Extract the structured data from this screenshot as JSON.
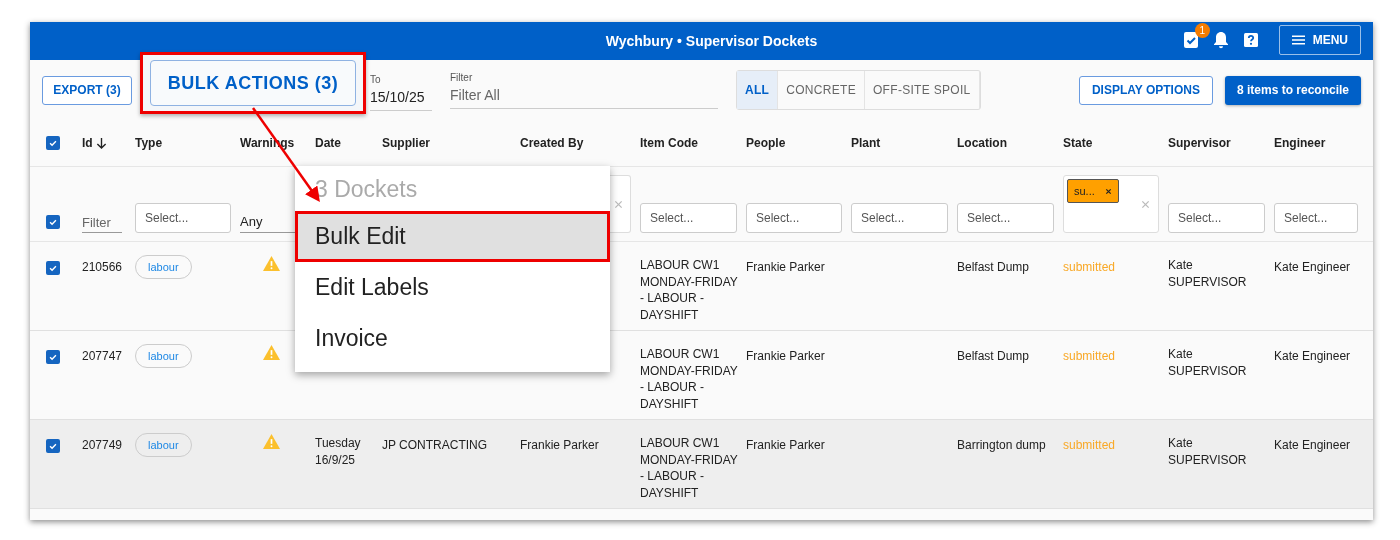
{
  "app_bar": {
    "title": "Wychbury • Supervisor Dockets",
    "task_badge": "1",
    "menu_label": "MENU"
  },
  "toolbar": {
    "export_label": "EXPORT (3)",
    "bulk_label": "BULK ACTIONS (3)",
    "to_field": {
      "label": "To",
      "value": "15/10/25"
    },
    "filter_field": {
      "label": "Filter",
      "placeholder": "Filter All"
    },
    "tabs": [
      {
        "label": "ALL",
        "selected": true
      },
      {
        "label": "CONCRETE",
        "selected": false
      },
      {
        "label": "OFF-SITE SPOIL",
        "selected": false
      }
    ],
    "display_options_label": "DISPLAY OPTIONS",
    "reconcile_label": "8 items to reconcile"
  },
  "table": {
    "select_all_checked": true,
    "columns": [
      {
        "label": "Id",
        "sorted": true
      },
      {
        "label": "Type",
        "sorted": false
      },
      {
        "label": "Warnings",
        "sorted": false
      },
      {
        "label": "Date",
        "sorted": false
      },
      {
        "label": "Supplier",
        "sorted": false
      },
      {
        "label": "Created By",
        "sorted": false
      },
      {
        "label": "Item Code",
        "sorted": false
      },
      {
        "label": "People",
        "sorted": false
      },
      {
        "label": "Plant",
        "sorted": false
      },
      {
        "label": "Location",
        "sorted": false
      },
      {
        "label": "State",
        "sorted": false
      },
      {
        "label": "Supervisor",
        "sorted": false
      },
      {
        "label": "Engineer",
        "sorted": false
      }
    ],
    "filters": [
      {
        "kind": "checkbox",
        "checked": true
      },
      {
        "kind": "text",
        "placeholder": "Filter"
      },
      {
        "kind": "select",
        "placeholder": "Select..."
      },
      {
        "kind": "dropdown",
        "value": "Any"
      },
      {
        "kind": "blank"
      },
      {
        "kind": "blank"
      },
      {
        "kind": "chips"
      },
      {
        "kind": "select",
        "placeholder": "Select..."
      },
      {
        "kind": "select",
        "placeholder": "Select..."
      },
      {
        "kind": "select",
        "placeholder": "Select..."
      },
      {
        "kind": "select",
        "placeholder": "Select..."
      },
      {
        "kind": "chips",
        "chips": [
          "su..."
        ]
      },
      {
        "kind": "select",
        "placeholder": "Select..."
      },
      {
        "kind": "select",
        "placeholder": "Select..."
      }
    ],
    "rows": [
      {
        "checked": true,
        "highlighted": false,
        "id": "210566",
        "type": "labour",
        "warning": true,
        "item_code": "LABOUR CW1 MONDAY-FRIDAY - LABOUR - DAYSHIFT",
        "people": "Frankie Parker",
        "location": "Belfast Dump",
        "state": "submitted",
        "supervisor": "Kate SUPERVISOR",
        "engineer": "Kate Engineer"
      },
      {
        "checked": true,
        "highlighted": false,
        "id": "207747",
        "type": "labour",
        "warning": true,
        "item_code": "LABOUR CW1 MONDAY-FRIDAY - LABOUR - DAYSHIFT",
        "people": "Frankie Parker",
        "location": "Belfast Dump",
        "state": "submitted",
        "supervisor": "Kate SUPERVISOR",
        "engineer": "Kate Engineer"
      },
      {
        "checked": true,
        "highlighted": true,
        "id": "207749",
        "type": "labour",
        "warning": true,
        "date": "Tuesday 16/9/25",
        "supplier": "JP CONTRACTING",
        "created_by": "Frankie Parker",
        "item_code": "LABOUR CW1 MONDAY-FRIDAY - LABOUR - DAYSHIFT",
        "people": "Frankie Parker",
        "location": "Barrington dump",
        "state": "submitted",
        "supervisor": "Kate SUPERVISOR",
        "engineer": "Kate Engineer"
      }
    ]
  },
  "bulk_menu": {
    "heading": "3 Dockets",
    "items": [
      {
        "label": "Bulk Edit",
        "selected": true
      },
      {
        "label": "Edit Labels",
        "selected": false
      },
      {
        "label": "Invoice",
        "selected": false
      }
    ]
  }
}
